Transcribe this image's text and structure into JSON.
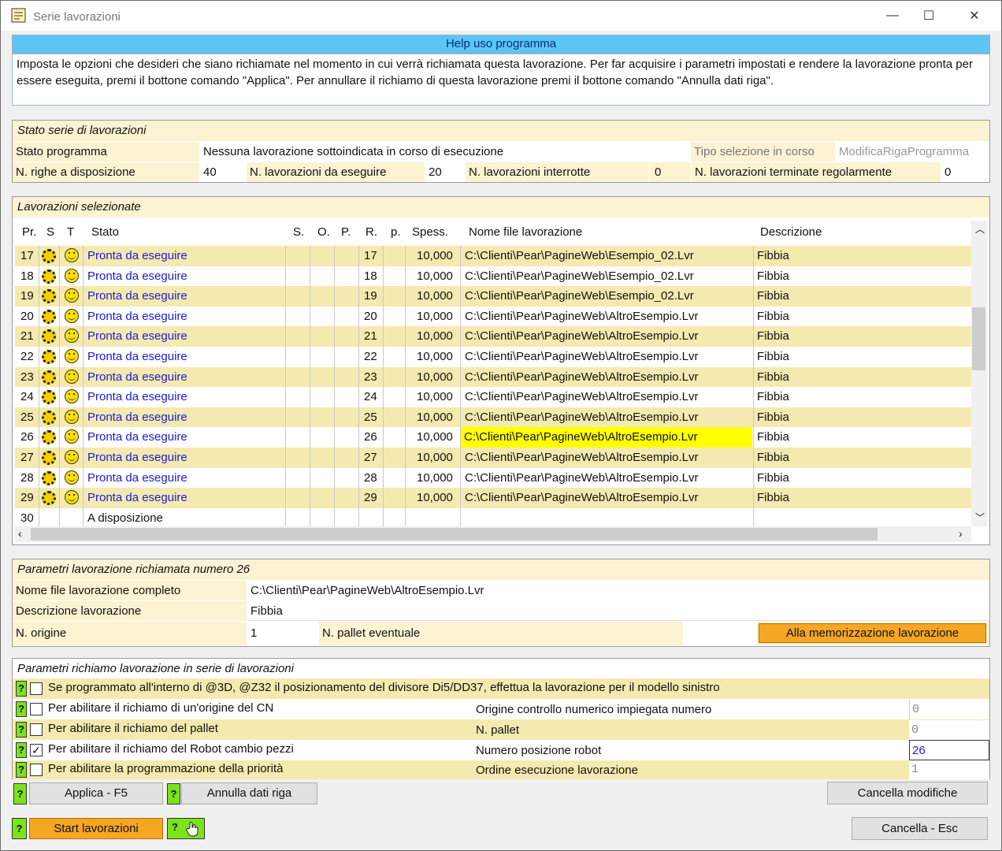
{
  "window": {
    "title": "Serie lavorazioni",
    "min": "—",
    "max": "☐",
    "close": "✕"
  },
  "help": {
    "title": "Help uso programma",
    "text": "Imposta le opzioni che desideri che siano richiamate nel momento in cui verrà richiamata questa lavorazione. Per far acquisire i parametri impostati e rendere la lavorazione pronta per essere eseguita, premi il bottone comando \"Applica\". Per annullare il richiamo di questa lavorazione premi il bottone comando \"Annulla dati riga\"."
  },
  "stato": {
    "title": "Stato serie di lavorazioni",
    "programma_label": "Stato programma",
    "programma_value": "Nessuna lavorazione sottoindicata in corso di esecuzione",
    "tipo_label": "Tipo selezione in corso",
    "tipo_value": "ModificaRigaProgramma",
    "righe_label": "N. righe a disposizione",
    "righe_value": "40",
    "daeseguire_label": "N. lavorazioni da eseguire",
    "daeseguire_value": "20",
    "interrotte_label": "N. lavorazioni interrotte",
    "interrotte_value": "0",
    "terminate_label": "N. lavorazioni terminate regolarmente",
    "terminate_value": "0"
  },
  "grid": {
    "title": "Lavorazioni selezionate",
    "columns": [
      "Pr.",
      "S",
      "T",
      "Stato",
      "S.",
      "O.",
      "P.",
      "R.",
      "p.",
      "Spess.",
      "Nome file lavorazione",
      "Descrizione"
    ],
    "rows": [
      {
        "pr": "17",
        "stato": "Pronta da eseguire",
        "r": "17",
        "spess": "10,000",
        "file": "C:\\Clienti\\Pear\\PagineWeb\\Esempio_02.Lvr",
        "desc": "Fibbia"
      },
      {
        "pr": "18",
        "stato": "Pronta da eseguire",
        "r": "18",
        "spess": "10,000",
        "file": "C:\\Clienti\\Pear\\PagineWeb\\Esempio_02.Lvr",
        "desc": "Fibbia"
      },
      {
        "pr": "19",
        "stato": "Pronta da eseguire",
        "r": "19",
        "spess": "10,000",
        "file": "C:\\Clienti\\Pear\\PagineWeb\\Esempio_02.Lvr",
        "desc": "Fibbia"
      },
      {
        "pr": "20",
        "stato": "Pronta da eseguire",
        "r": "20",
        "spess": "10,000",
        "file": "C:\\Clienti\\Pear\\PagineWeb\\AltroEsempio.Lvr",
        "desc": "Fibbia"
      },
      {
        "pr": "21",
        "stato": "Pronta da eseguire",
        "r": "21",
        "spess": "10,000",
        "file": "C:\\Clienti\\Pear\\PagineWeb\\AltroEsempio.Lvr",
        "desc": "Fibbia"
      },
      {
        "pr": "22",
        "stato": "Pronta da eseguire",
        "r": "22",
        "spess": "10,000",
        "file": "C:\\Clienti\\Pear\\PagineWeb\\AltroEsempio.Lvr",
        "desc": "Fibbia"
      },
      {
        "pr": "23",
        "stato": "Pronta da eseguire",
        "r": "23",
        "spess": "10,000",
        "file": "C:\\Clienti\\Pear\\PagineWeb\\AltroEsempio.Lvr",
        "desc": "Fibbia"
      },
      {
        "pr": "24",
        "stato": "Pronta da eseguire",
        "r": "24",
        "spess": "10,000",
        "file": "C:\\Clienti\\Pear\\PagineWeb\\AltroEsempio.Lvr",
        "desc": "Fibbia"
      },
      {
        "pr": "25",
        "stato": "Pronta da eseguire",
        "r": "25",
        "spess": "10,000",
        "file": "C:\\Clienti\\Pear\\PagineWeb\\AltroEsempio.Lvr",
        "desc": "Fibbia"
      },
      {
        "pr": "26",
        "stato": "Pronta da eseguire",
        "r": "26",
        "spess": "10,000",
        "file": "C:\\Clienti\\Pear\\PagineWeb\\AltroEsempio.Lvr",
        "desc": "Fibbia",
        "highlight": true
      },
      {
        "pr": "27",
        "stato": "Pronta da eseguire",
        "r": "27",
        "spess": "10,000",
        "file": "C:\\Clienti\\Pear\\PagineWeb\\AltroEsempio.Lvr",
        "desc": "Fibbia"
      },
      {
        "pr": "28",
        "stato": "Pronta da eseguire",
        "r": "28",
        "spess": "10,000",
        "file": "C:\\Clienti\\Pear\\PagineWeb\\AltroEsempio.Lvr",
        "desc": "Fibbia"
      },
      {
        "pr": "29",
        "stato": "Pronta da eseguire",
        "r": "29",
        "spess": "10,000",
        "file": "C:\\Clienti\\Pear\\PagineWeb\\AltroEsempio.Lvr",
        "desc": "Fibbia"
      },
      {
        "pr": "30",
        "stato": "A disposizione",
        "r": "",
        "spess": "",
        "file": "",
        "desc": "",
        "empty": true
      }
    ]
  },
  "params": {
    "title": "Parametri lavorazione richiamata numero 26",
    "file_label": "Nome file lavorazione completo",
    "file_value": "C:\\Clienti\\Pear\\PagineWeb\\AltroEsempio.Lvr",
    "desc_label": "Descrizione lavorazione",
    "desc_value": "Fibbia",
    "origine_label": "N. origine",
    "origine_value": "1",
    "pallet_label": "N. pallet eventuale",
    "pallet_value": "",
    "memo_button": "Alla memorizzazione lavorazione"
  },
  "richiamo": {
    "title": "Parametri richiamo lavorazione in serie di lavorazioni",
    "opt1": "Se programmato all'interno di   @3D, @Z32 il posizionamento del divisore Di5/DD37, effettua la lavorazione per il modello sinistro",
    "opt2": "Per abilitare il richiamo di un'origine del CN",
    "opt2_field": "Origine controllo numerico impiegata numero",
    "opt2_value": "0",
    "opt3": "Per abilitare il richiamo del pallet",
    "opt3_field": "N. pallet",
    "opt3_value": "0",
    "opt4": "Per abilitare il richiamo del Robot cambio pezzi",
    "opt4_field": "Numero posizione robot",
    "opt4_value": "26",
    "opt5": "Per abilitare la programmazione della priorità",
    "opt5_field": "Ordine esecuzione lavorazione",
    "opt5_value": "1",
    "check_mark": "✓",
    "qmark": "?"
  },
  "buttons": {
    "applica": "Applica - F5",
    "annulla": "Annulla dati riga",
    "cancella_modifiche": "Cancella modifiche",
    "start": "Start lavorazioni",
    "cancella_esc": "Cancella - Esc"
  }
}
